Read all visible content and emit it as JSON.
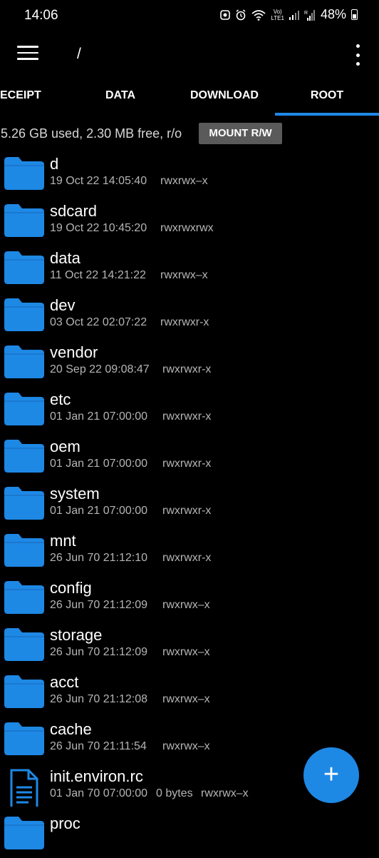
{
  "status_bar": {
    "time": "14:06",
    "battery_percent": "48%",
    "network_label": "LTE1",
    "icons": [
      "photo-icon",
      "alarm-icon",
      "wifi-icon",
      "volte-icon",
      "signal-icon",
      "signal-roaming-icon",
      "battery-icon"
    ]
  },
  "app_bar": {
    "path": "/",
    "menu_icon": "menu-icon",
    "more_icon": "more-vert-icon"
  },
  "tabs": [
    {
      "label": "ECEIPT",
      "selected": false
    },
    {
      "label": "DATA",
      "selected": false
    },
    {
      "label": "DOWNLOAD",
      "selected": false
    },
    {
      "label": "ROOT",
      "selected": true
    }
  ],
  "storage": {
    "info": "5.26 GB used, 2.30 MB free, r/o",
    "mount_label": "MOUNT R/W"
  },
  "files": [
    {
      "name": "d",
      "date": "19 Oct 22 14:05:40",
      "size": "",
      "perm": "rwxrwx–x",
      "type": "folder"
    },
    {
      "name": "sdcard",
      "date": "19 Oct 22 10:45:20",
      "size": "",
      "perm": "rwxrwxrwx",
      "type": "folder"
    },
    {
      "name": "data",
      "date": "11 Oct 22 14:21:22",
      "size": "",
      "perm": "rwxrwx–x",
      "type": "folder"
    },
    {
      "name": "dev",
      "date": "03 Oct 22 02:07:22",
      "size": "",
      "perm": "rwxrwxr-x",
      "type": "folder"
    },
    {
      "name": "vendor",
      "date": "20 Sep 22 09:08:47",
      "size": "",
      "perm": "rwxrwxr-x",
      "type": "folder"
    },
    {
      "name": "etc",
      "date": "01 Jan 21 07:00:00",
      "size": "",
      "perm": "rwxrwxr-x",
      "type": "folder"
    },
    {
      "name": "oem",
      "date": "01 Jan 21 07:00:00",
      "size": "",
      "perm": "rwxrwxr-x",
      "type": "folder"
    },
    {
      "name": "system",
      "date": "01 Jan 21 07:00:00",
      "size": "",
      "perm": "rwxrwxr-x",
      "type": "folder"
    },
    {
      "name": "mnt",
      "date": "26 Jun 70 21:12:10",
      "size": "",
      "perm": "rwxrwxr-x",
      "type": "folder"
    },
    {
      "name": "config",
      "date": "26 Jun 70 21:12:09",
      "size": "",
      "perm": "rwxrwx–x",
      "type": "folder"
    },
    {
      "name": "storage",
      "date": "26 Jun 70 21:12:09",
      "size": "",
      "perm": "rwxrwx–x",
      "type": "folder"
    },
    {
      "name": "acct",
      "date": "26 Jun 70 21:12:08",
      "size": "",
      "perm": "rwxrwx–x",
      "type": "folder"
    },
    {
      "name": "cache",
      "date": "26 Jun 70 21:11:54",
      "size": "",
      "perm": "rwxrwx–x",
      "type": "folder"
    },
    {
      "name": "init.environ.rc",
      "date": "01 Jan 70 07:00:00",
      "size": "0 bytes",
      "perm": "rwxrwx–x",
      "type": "file"
    },
    {
      "name": "proc",
      "date": "",
      "size": "",
      "perm": "",
      "type": "folder"
    }
  ],
  "fab": {
    "label": "+",
    "icon": "add-icon"
  },
  "colors": {
    "accent": "#1e88e5",
    "folder": "#1e88e5",
    "background": "#000000",
    "mount_button": "#5a5a5a"
  }
}
